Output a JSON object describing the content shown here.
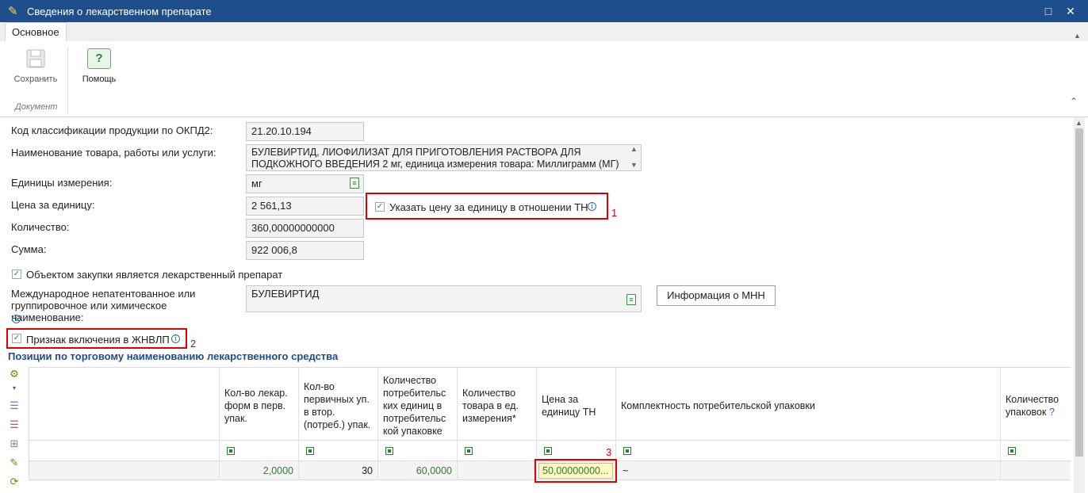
{
  "window": {
    "title": "Сведения о лекарственном препарате",
    "maximize_glyph": "□",
    "close_glyph": "✕"
  },
  "ribbon": {
    "tab_main": "Основное",
    "save_label": "Сохранить",
    "help_label": "Помощь",
    "help_glyph": "?",
    "group_document": "Документ"
  },
  "form": {
    "okpd2_label": "Код классификации продукции по ОКПД2:",
    "okpd2_value": "21.20.10.194",
    "name_label": "Наименование товара, работы или услуги:",
    "name_value": "БУЛЕВИРТИД, ЛИОФИЛИЗАТ ДЛЯ ПРИГОТОВЛЕНИЯ РАСТВОРА ДЛЯ ПОДКОЖНОГО ВВЕДЕНИЯ 2 мг, единица измерения товара: Миллиграмм (МГ)",
    "unit_label": "Единицы измерения:",
    "unit_value": "мг",
    "price_label": "Цена за единицу:",
    "price_value": "2 561,13",
    "price_tn_checkbox": "Указать цену за единицу в отношении ТН",
    "quantity_label": "Количество:",
    "quantity_value": "360,00000000000",
    "sum_label": "Сумма:",
    "sum_value": "922 006,8",
    "is_drug_checkbox": "Объектом закупки является лекарственный препарат",
    "mnn_label": "Международное непатентованное или группировочное или химическое наименование:",
    "mnn_value": "БУЛЕВИРТИД",
    "mnn_info_button": "Информация о МНН",
    "zhnvlp_checkbox": "Признак включения в ЖНВЛП"
  },
  "markers": {
    "m1": "1",
    "m2": "2",
    "m3": "3"
  },
  "grid": {
    "section_title": "Позиции по торговому наименованию лекарственного средства",
    "columns": [
      "Кол-во лекар. форм в перв. упак.",
      "Кол-во первичных уп. в втор. (потреб.) упак.",
      "Количество потребительс ких единиц в потребительс кой упаковке",
      "Количество товара в ед. измерения*",
      "Цена за единицу ТН",
      "Комплектность потребительской упаковки",
      "Количество упаковок"
    ],
    "help_mark": "?",
    "row": {
      "forms_per_pack": "2,0000",
      "primary_packs": "30",
      "consumer_units": "60,0000",
      "qty_in_units": "",
      "price_per_tn": "50,00000000...",
      "completeness": "~",
      "packs_count": ""
    }
  },
  "colors": {
    "titlebar": "#1e4e8c",
    "accent": "#1a4d8f",
    "highlight_red": "#e00000",
    "value_green": "#2e7d32"
  }
}
